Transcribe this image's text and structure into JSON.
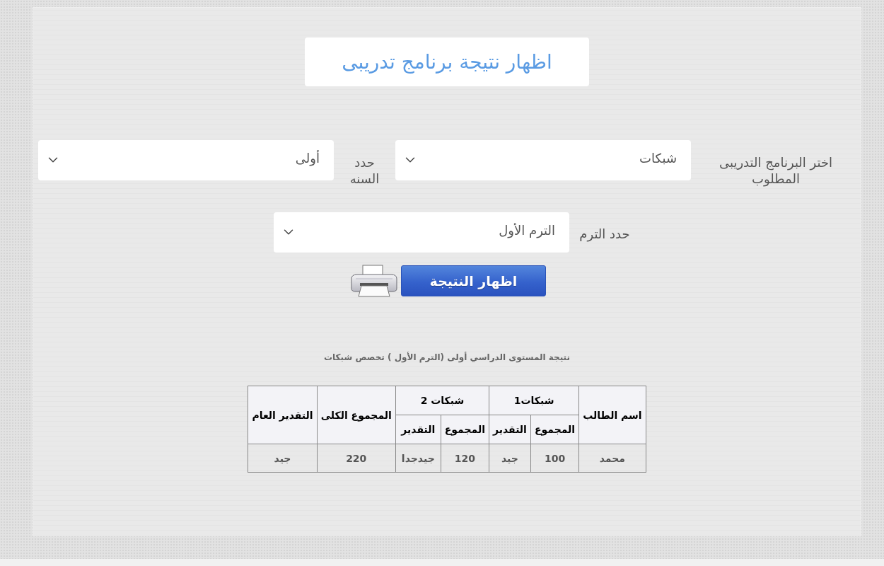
{
  "header": {
    "title": "اظهار نتيجة برنامج تدريبى"
  },
  "filter_rows": [
    [
      {
        "label": "اختر البرنامج التدريبى المطلوب",
        "value": "شبكات"
      },
      {
        "label": "حدد السنه",
        "value": "أولى"
      }
    ],
    [
      {
        "label": "حدد الترم",
        "value": "الترم الأول"
      }
    ]
  ],
  "actions": {
    "show_button": "اظهار النتيجة"
  },
  "result": {
    "caption": "نتيجة المستوى الدراسي أولى (الترم الأول ) تخصص شبكات",
    "table": {
      "columns": [
        {
          "label": "اسم الطالب"
        },
        {
          "label": "شبكات1",
          "colspan": 2,
          "children": [
            {
              "label": "المجموع"
            },
            {
              "label": "التقدير"
            }
          ]
        },
        {
          "label": "شبكات 2",
          "colspan": 2,
          "children": [
            {
              "label": "المجموع"
            },
            {
              "label": "التقدير"
            }
          ]
        },
        {
          "label": "المجموع الكلى"
        },
        {
          "label": "التقدير العام"
        }
      ],
      "rows": [
        [
          "محمد",
          "100",
          "جيد",
          "120",
          "جيدجدا",
          "220",
          "جيد"
        ]
      ]
    }
  }
}
